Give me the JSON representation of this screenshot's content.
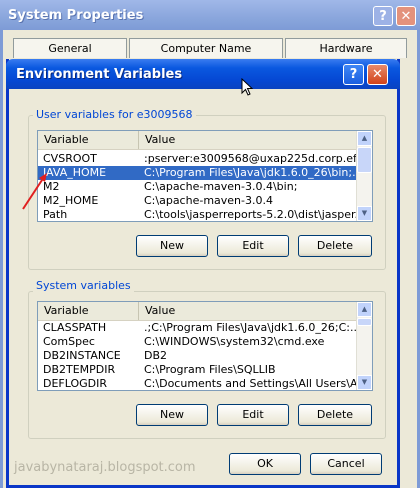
{
  "outer_window": {
    "title": "System Properties",
    "help_glyph": "?",
    "close_glyph": "✕",
    "tabs": [
      "General",
      "Computer Name",
      "Hardware"
    ]
  },
  "dialog": {
    "title": "Environment Variables",
    "help_glyph": "?",
    "close_glyph": "✕",
    "user_section": {
      "label": "User variables for e3009568",
      "columns": [
        "Variable",
        "Value"
      ],
      "rows": [
        {
          "variable": "CVSROOT",
          "value": ":pserver:e3009568@uxap225d.corp.ef..."
        },
        {
          "variable": "JAVA_HOME",
          "value": "C:\\Program Files\\Java\\jdk1.6.0_26\\bin;..."
        },
        {
          "variable": "M2",
          "value": "C:\\apache-maven-3.0.4\\bin;"
        },
        {
          "variable": "M2_HOME",
          "value": "C:\\apache-maven-3.0.4"
        },
        {
          "variable": "Path",
          "value": "C:\\tools\\jasperreports-5.2.0\\dist\\jasper..."
        }
      ],
      "buttons": {
        "new": "New",
        "edit": "Edit",
        "delete": "Delete"
      }
    },
    "system_section": {
      "label": "System variables",
      "columns": [
        "Variable",
        "Value"
      ],
      "rows": [
        {
          "variable": "CLASSPATH",
          "value": ".;C:\\Program Files\\Java\\jdk1.6.0_26;C:..."
        },
        {
          "variable": "ComSpec",
          "value": "C:\\WINDOWS\\system32\\cmd.exe"
        },
        {
          "variable": "DB2INSTANCE",
          "value": "DB2"
        },
        {
          "variable": "DB2TEMPDIR",
          "value": "C:\\Program Files\\SQLLIB"
        },
        {
          "variable": "DEFLOGDIR",
          "value": "C:\\Documents and Settings\\All Users\\A..."
        }
      ],
      "buttons": {
        "new": "New",
        "edit": "Edit",
        "delete": "Delete"
      }
    },
    "footer": {
      "ok": "OK",
      "cancel": "Cancel"
    }
  },
  "watermark": "javabynataraj.blogspot.com",
  "colors": {
    "selection": "#316ac5",
    "arrow": "#e02020"
  }
}
